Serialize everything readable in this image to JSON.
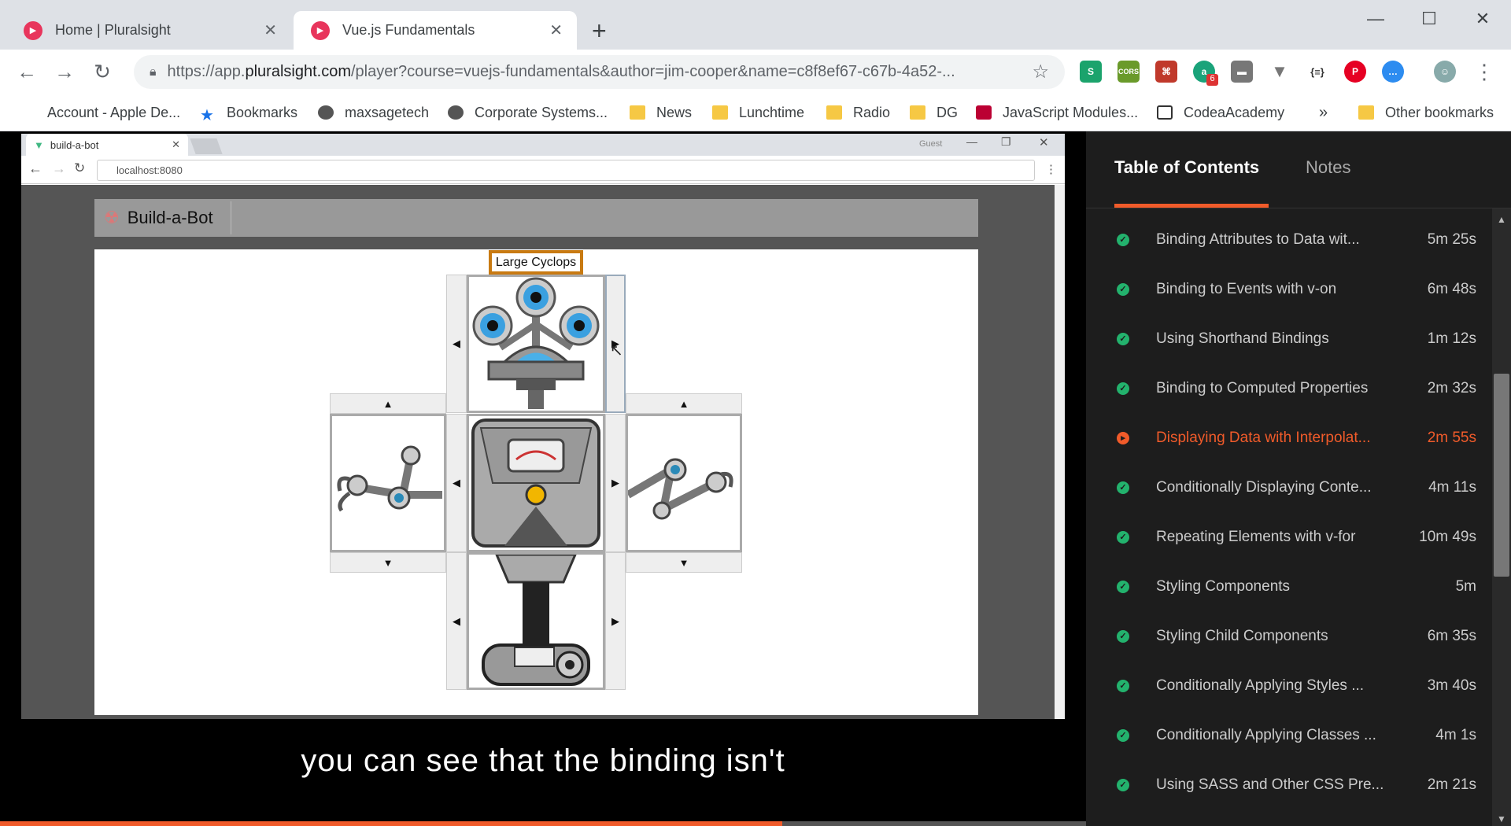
{
  "browser": {
    "tabs": [
      {
        "title": "Home | Pluralsight",
        "active": false
      },
      {
        "title": "Vue.js Fundamentals",
        "active": true
      }
    ],
    "url_prefix": "https://app.",
    "url_host": "pluralsight.com",
    "url_path": "/player?course=vuejs-fundamentals&author=jim-cooper&name=c8f8ef67-c67b-4a52-...",
    "bookmarks": [
      {
        "label": "Account - Apple De...",
        "icon": "apple-icon"
      },
      {
        "label": "Bookmarks",
        "icon": "star-icon"
      },
      {
        "label": "maxsagetech",
        "icon": "globe-icon"
      },
      {
        "label": "Corporate Systems...",
        "icon": "globe-icon"
      },
      {
        "label": "News",
        "icon": "folder-icon"
      },
      {
        "label": "Lunchtime",
        "icon": "folder-icon"
      },
      {
        "label": "Radio",
        "icon": "folder-icon"
      },
      {
        "label": "DG",
        "icon": "folder-icon"
      },
      {
        "label": "JavaScript Modules...",
        "icon": "site-icon"
      },
      {
        "label": "CodeaAcademy",
        "icon": "site-icon"
      }
    ],
    "overflow": "»",
    "other_bookmarks": "Other bookmarks",
    "extension_badge": "6"
  },
  "inner_browser": {
    "tab_title": "build-a-bot",
    "url": "localhost:8080",
    "profile": "Guest"
  },
  "app": {
    "title": "Build-a-Bot",
    "selected_head_label": "Large Cyclops"
  },
  "caption": "you can see that the binding isn't",
  "progress": 0.72,
  "sidebar": {
    "tabs": [
      "Table of Contents",
      "Notes"
    ],
    "items": [
      {
        "title": "Binding Attributes to Data wit...",
        "duration": "5m 25s",
        "status": "done"
      },
      {
        "title": "Binding to Events with v-on",
        "duration": "6m 48s",
        "status": "done"
      },
      {
        "title": "Using Shorthand Bindings",
        "duration": "1m 12s",
        "status": "done"
      },
      {
        "title": "Binding to Computed Properties",
        "duration": "2m 32s",
        "status": "done"
      },
      {
        "title": "Displaying Data with Interpolat...",
        "duration": "2m 55s",
        "status": "current"
      },
      {
        "title": "Conditionally Displaying Conte...",
        "duration": "4m 11s",
        "status": "done"
      },
      {
        "title": "Repeating Elements with v-for",
        "duration": "10m 49s",
        "status": "done"
      },
      {
        "title": "Styling Components",
        "duration": "5m",
        "status": "done"
      },
      {
        "title": "Styling Child Components",
        "duration": "6m 35s",
        "status": "done"
      },
      {
        "title": "Conditionally Applying Styles ...",
        "duration": "3m 40s",
        "status": "done"
      },
      {
        "title": "Conditionally Applying Classes ...",
        "duration": "4m 1s",
        "status": "done"
      },
      {
        "title": "Using SASS and Other CSS Pre...",
        "duration": "2m 21s",
        "status": "done"
      }
    ]
  },
  "colors": {
    "accent": "#f15b2a",
    "done": "#23b26d"
  }
}
